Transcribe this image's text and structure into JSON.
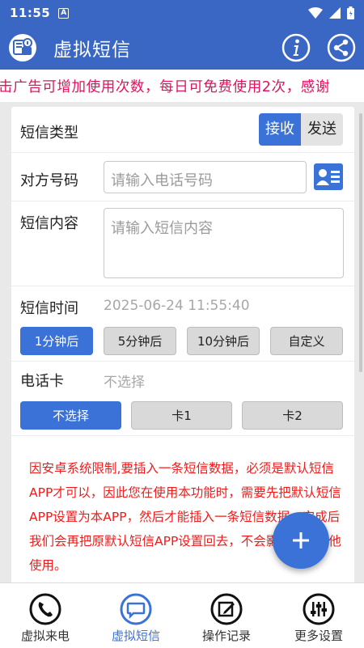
{
  "status_bar": {
    "time": "11:55",
    "notif_icon": "A"
  },
  "app_bar": {
    "title": "虚拟短信",
    "logo_icon": "sms-logo-icon",
    "actions": [
      "info-icon",
      "share-icon"
    ]
  },
  "marquee": {
    "text": "击广告可增加使用次数，每日可免费使用2次，感谢"
  },
  "form": {
    "sms_type": {
      "label": "短信类型",
      "options": [
        "接收",
        "发送"
      ],
      "selected": "接收"
    },
    "phone": {
      "label": "对方号码",
      "placeholder": "请输入电话号码"
    },
    "content": {
      "label": "短信内容",
      "placeholder": "请输入短信内容"
    },
    "time": {
      "label": "短信时间",
      "value": "2025-06-24 11:55:40",
      "presets": [
        "1分钟后",
        "5分钟后",
        "10分钟后",
        "自定义"
      ],
      "selected": "1分钟后"
    },
    "sim": {
      "label": "电话卡",
      "value": "不选择",
      "options": [
        "不选择",
        "卡1",
        "卡2"
      ],
      "selected": "不选择"
    }
  },
  "notice": "因安卓系统限制,要插入一条短信数据，必须是默认短信APP才可以，因此您在使用本功能时，需要先把默认短信APP设置为本APP，然后才能插入一条短信数据。完成后我们会再把原默认短信APP设置回去，不会影响您的其他使用。",
  "fab": {
    "icon": "plus-icon"
  },
  "bottom_nav": [
    {
      "label": "虚拟来电",
      "icon": "phone-icon"
    },
    {
      "label": "虚拟短信",
      "icon": "message-icon",
      "active": true
    },
    {
      "label": "操作记录",
      "icon": "edit-icon"
    },
    {
      "label": "更多设置",
      "icon": "settings-icon"
    }
  ],
  "colors": {
    "primary": "#3a66c4",
    "accent": "#3a72d8",
    "notice_red": "#ee1c1c",
    "marquee_pink": "#e0135e"
  }
}
